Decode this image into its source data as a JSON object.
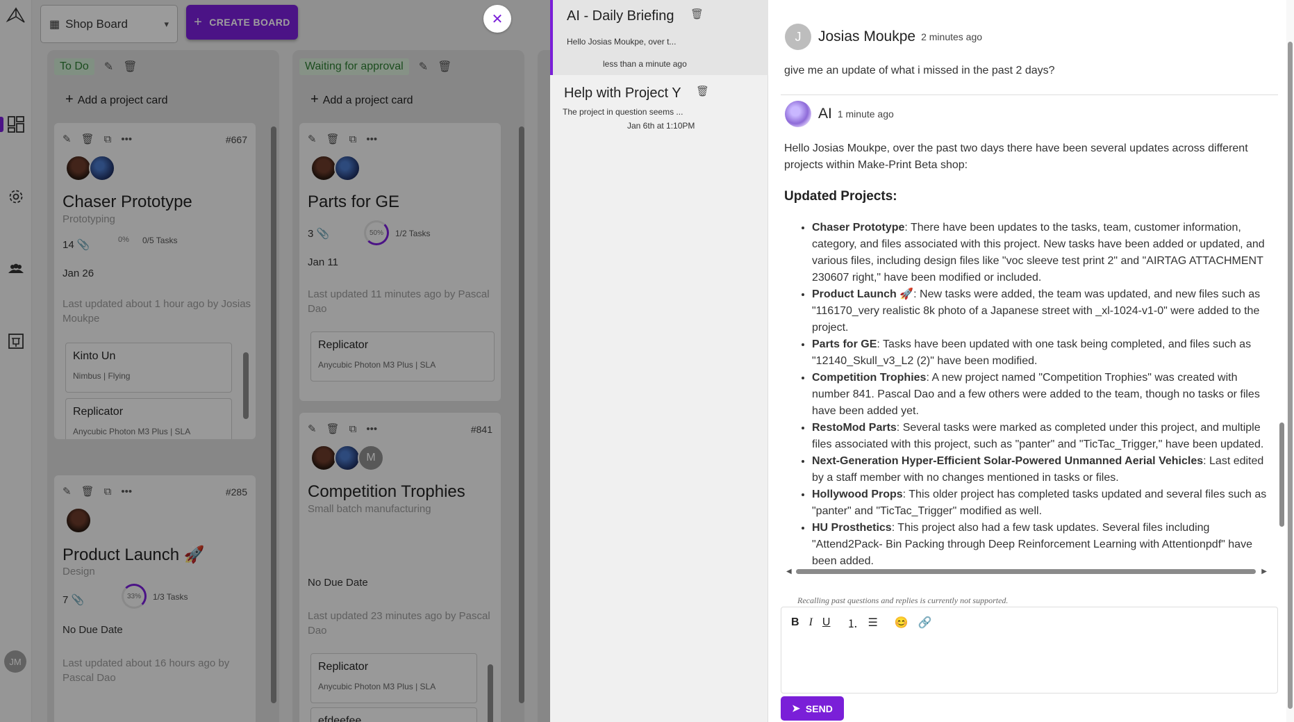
{
  "board": {
    "selected": "Shop Board",
    "create_label": "CREATE BOARD"
  },
  "sidebar": {
    "avatar_initials": "JM"
  },
  "columns": [
    {
      "status": "To Do",
      "add_label": "Add a project card"
    },
    {
      "status": "Waiting for approval",
      "add_label": "Add a project card"
    }
  ],
  "cards": {
    "c667": {
      "number": "#667",
      "title": "Chaser Prototype",
      "category": "Prototyping",
      "attachments": "14",
      "progress": "0%",
      "tasks": "0/5 Tasks",
      "due": "Jan 26",
      "updated": "Last updated about 1 hour ago by Josias Moukpe",
      "subcards": [
        {
          "name": "Kinto Un",
          "detail": "Nimbus | Flying"
        },
        {
          "name": "Replicator",
          "detail": "Anycubic Photon M3 Plus | SLA"
        }
      ]
    },
    "c285": {
      "number": "#285",
      "title": "Product Launch 🚀",
      "category": "Design",
      "attachments": "7",
      "progress": "33%",
      "tasks": "1/3 Tasks",
      "due": "No Due Date",
      "updated": "Last updated about 16 hours ago by Pascal Dao"
    },
    "cGE": {
      "title": "Parts for GE",
      "attachments": "3",
      "progress": "50%",
      "tasks": "1/2 Tasks",
      "due": "Jan 11",
      "updated": "Last updated 11 minutes ago by Pascal Dao",
      "subcards": [
        {
          "name": "Replicator",
          "detail": "Anycubic Photon M3 Plus | SLA"
        }
      ]
    },
    "c841": {
      "number": "#841",
      "title": "Competition Trophies",
      "category": "Small batch manufacturing",
      "avatar_initial": "M",
      "due": "No Due Date",
      "updated": "Last updated 23 minutes ago by Pascal Dao",
      "subcards": [
        {
          "name": "Replicator",
          "detail": "Anycubic Photon M3 Plus | SLA"
        },
        {
          "name": "efdeefee",
          "detail": ""
        }
      ]
    }
  },
  "chats": [
    {
      "title": "AI - Daily Briefing",
      "preview": "Hello Josias Moukpe, over t...",
      "time": "less than a minute ago"
    },
    {
      "title": "Help with Project Y",
      "preview": "The project in question seems ...",
      "time": "Jan 6th at 1:10PM"
    }
  ],
  "conversation": {
    "user": {
      "initial": "J",
      "name": "Josias Moukpe",
      "time": "2 minutes ago",
      "text": "give me an update of what i missed in the past 2 days?"
    },
    "ai": {
      "name": "AI",
      "time": "1 minute ago",
      "intro": "Hello Josias Moukpe, over the past two days there have been several updates across different projects within Make-Print Beta shop:",
      "heading": "Updated Projects:",
      "items": [
        {
          "name": "Chaser Prototype",
          "text": ": There have been updates to the tasks, team, customer information, category, and files associated with this project. New tasks have been added or updated, and various files, including design files like \"voc sleeve test print 2\" and \"AIRTAG ATTACHMENT 230607 right,\" have been modified or included."
        },
        {
          "name": "Product Launch 🚀",
          "text": ": New tasks were added, the team was updated, and new files such as \"116170_very realistic 8k photo of a Japanese street with _xl-1024-v1-0\" were added to the project."
        },
        {
          "name": "Parts for GE",
          "text": ": Tasks have been updated with one task being completed, and files such as \"12140_Skull_v3_L2 (2)\" have been modified."
        },
        {
          "name": "Competition Trophies",
          "text": ": A new project named \"Competition Trophies\" was created with number 841. Pascal Dao and a few others were added to the team, though no tasks or files have been added yet."
        },
        {
          "name": "RestoMod Parts",
          "text": ": Several tasks were marked as completed under this project, and multiple files associated with this project, such as \"panter\" and \"TicTac_Trigger,\" have been updated."
        },
        {
          "name": "Next-Generation Hyper-Efficient Solar-Powered Unmanned Aerial Vehicles",
          "text": ": Last edited by a staff member with no changes mentioned in tasks or files."
        },
        {
          "name": "Hollywood Props",
          "text": ": This older project has completed tasks updated and several files such as \"panter\" and \"TicTac_Trigger\" modified as well."
        },
        {
          "name": "HU Prosthetics",
          "text": ": This project also had a few task updates. Several files including \"Attend2Pack- Bin Packing through Deep Reinforcement Learning with Attentionpdf\" have been added."
        }
      ]
    }
  },
  "composer": {
    "note": "Recalling past questions and replies is currently not supported.",
    "send_label": "SEND"
  },
  "colors": {
    "accent": "#7a1fd8",
    "tag_bg": "#cfe9d2",
    "tag_text": "#2e7d32"
  }
}
